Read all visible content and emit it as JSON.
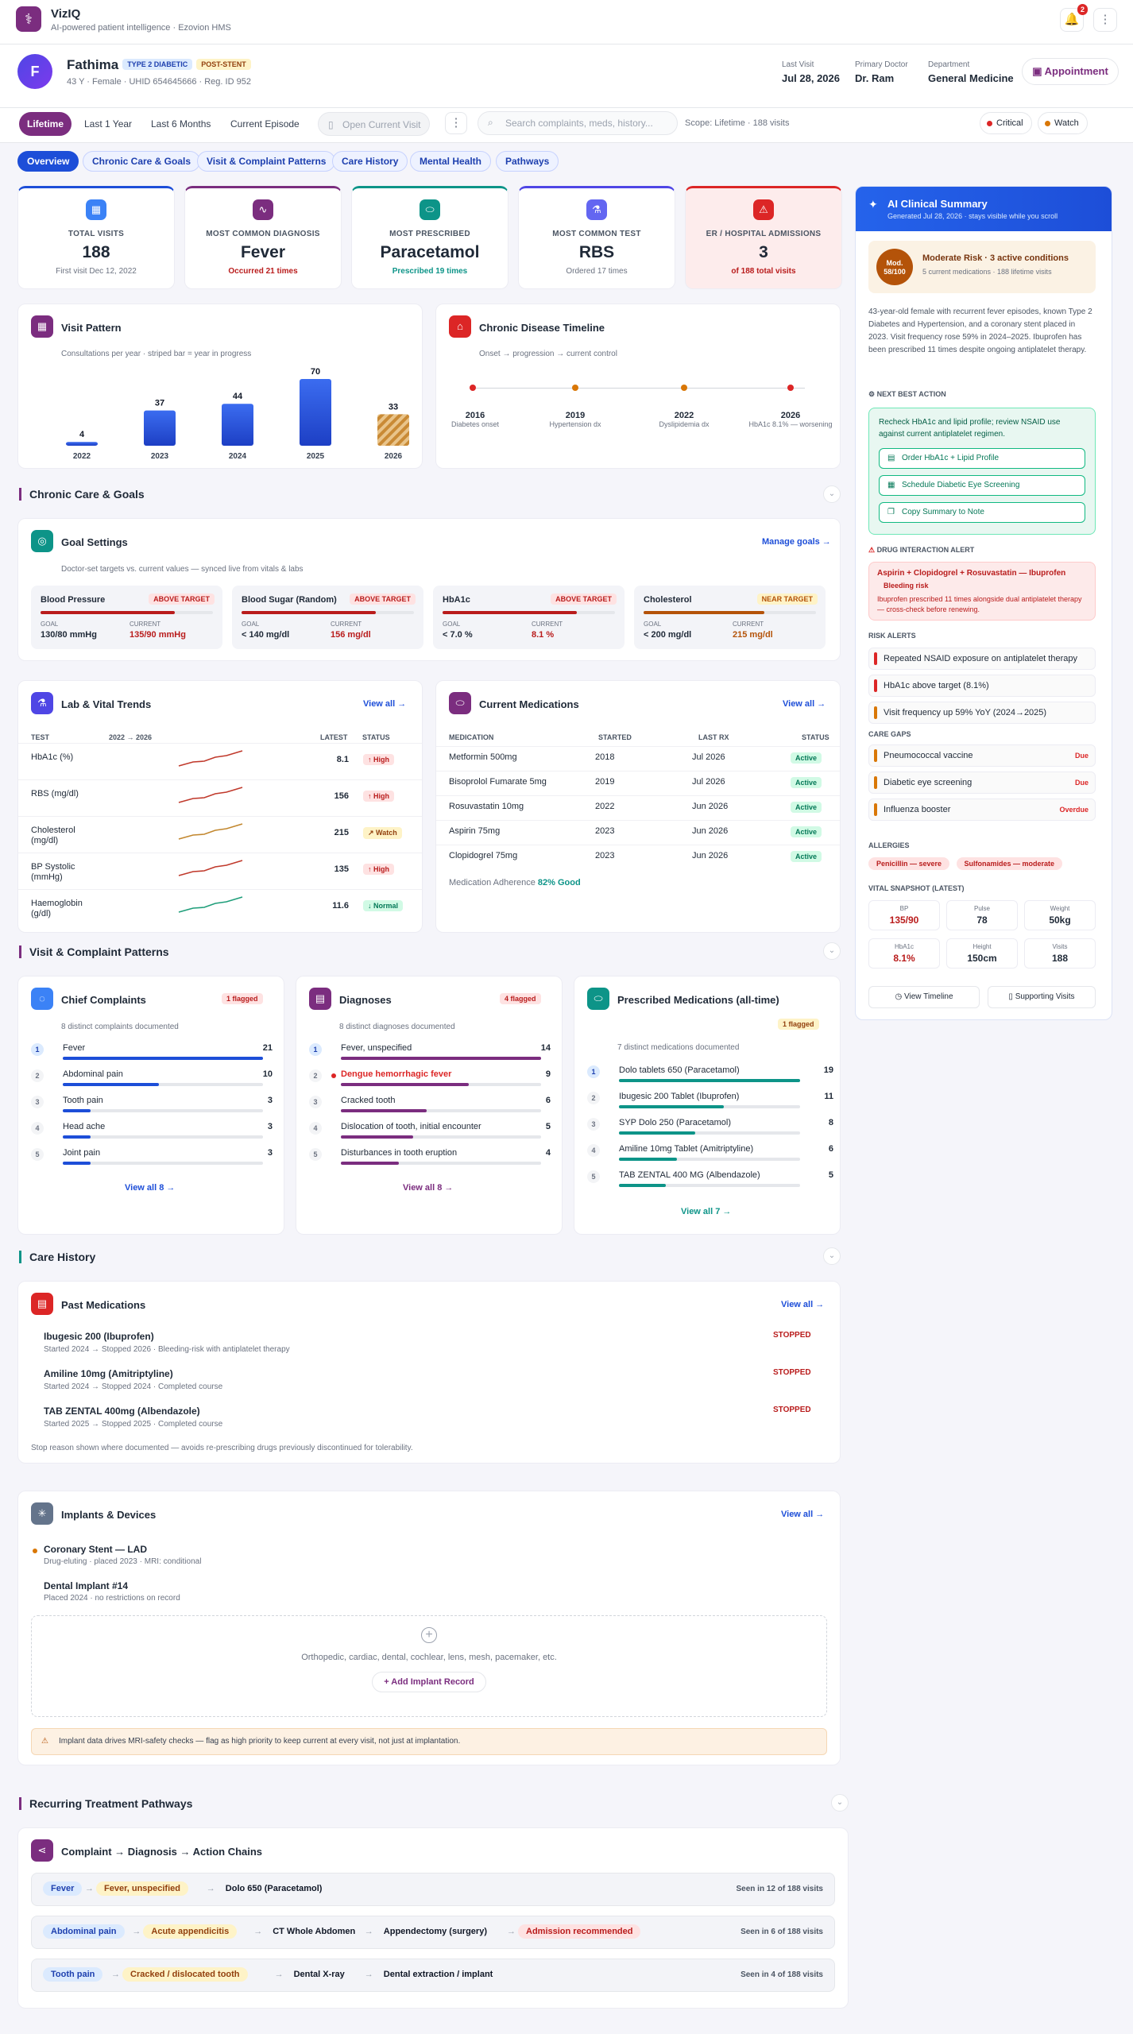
{
  "app": {
    "title": "VizIQ",
    "subtitle": "AI-powered patient intelligence · Ezovion HMS",
    "notifications": "2"
  },
  "patient": {
    "initial": "F",
    "name": "Fathima",
    "tags": [
      "TYPE 2 DIABETIC",
      "POST-STENT"
    ],
    "meta": "43 Y · Female · UHID 654645666 · Reg. ID 952",
    "last_visit_label": "Last Visit",
    "last_visit": "Jul 28, 2026",
    "doctor_label": "Primary Doctor",
    "doctor": "Dr. Ram",
    "dept_label": "Department",
    "dept": "General Medicine",
    "appointment": "Appointment"
  },
  "filters": {
    "chips": [
      "Lifetime",
      "Last 1 Year",
      "Last 6 Months",
      "Current Episode"
    ],
    "open_visit": "Open Current Visit",
    "search_placeholder": "Search complaints, meds, history...",
    "scope": "Scope: Lifetime · 188 visits",
    "legend": [
      "Critical",
      "Watch"
    ]
  },
  "tabs": [
    "Overview",
    "Chronic Care & Goals",
    "Visit & Complaint Patterns",
    "Care History",
    "Mental Health",
    "Pathways"
  ],
  "stats": [
    {
      "label": "TOTAL VISITS",
      "value": "188",
      "sub": "First visit Dec 12, 2022"
    },
    {
      "label": "MOST COMMON DIAGNOSIS",
      "value": "Fever",
      "sub": "Occurred 21 times"
    },
    {
      "label": "MOST PRESCRIBED",
      "value": "Paracetamol",
      "sub": "Prescribed 19 times"
    },
    {
      "label": "MOST COMMON TEST",
      "value": "RBS",
      "sub": "Ordered 17 times"
    },
    {
      "label": "ER / HOSPITAL ADMISSIONS",
      "value": "3",
      "sub": "of 188 total visits"
    }
  ],
  "visit_pattern": {
    "title": "Visit Pattern",
    "subtitle": "Consultations per year · striped bar = year in progress",
    "chart_data": {
      "type": "bar",
      "categories": [
        "2022",
        "2023",
        "2024",
        "2025",
        "2026"
      ],
      "values": [
        4,
        37,
        44,
        70,
        33
      ],
      "title": "Visit Pattern"
    }
  },
  "chronic_timeline": {
    "title": "Chronic Disease Timeline",
    "subtitle": "Onset → progression → current control",
    "events": [
      {
        "year": "2016",
        "label": "Diabetes onset"
      },
      {
        "year": "2019",
        "label": "Hypertension dx"
      },
      {
        "year": "2022",
        "label": "Dyslipidemia dx"
      },
      {
        "year": "2026",
        "label": "HbA1c 8.1% — worsening"
      }
    ]
  },
  "sections": {
    "chronic": "Chronic Care & Goals",
    "patterns": "Visit & Complaint Patterns",
    "history": "Care History",
    "pathways": "Recurring Treatment Pathways"
  },
  "goals": {
    "title": "Goal Settings",
    "subtitle": "Doctor-set targets vs. current values — synced live from vitals & labs",
    "manage": "Manage goals →",
    "goal_label": "GOAL",
    "current_label": "CURRENT",
    "items": [
      {
        "name": "Blood Pressure",
        "status": "ABOVE TARGET",
        "goal": "130/80 mmHg",
        "current": "135/90 mmHg"
      },
      {
        "name": "Blood Sugar (Random)",
        "status": "ABOVE TARGET",
        "goal": "< 140 mg/dl",
        "current": "156 mg/dl"
      },
      {
        "name": "HbA1c",
        "status": "ABOVE TARGET",
        "goal": "< 7.0 %",
        "current": "8.1 %"
      },
      {
        "name": "Cholesterol",
        "status": "NEAR TARGET",
        "goal": "< 200 mg/dl",
        "current": "215 mg/dl"
      }
    ]
  },
  "labs": {
    "title": "Lab & Vital Trends",
    "view_all": "View all →",
    "headers": [
      "TEST",
      "2022 → 2026",
      "LATEST",
      "STATUS"
    ],
    "rows": [
      {
        "test": "HbA1c (%)",
        "latest": "8.1",
        "status": "↑ High"
      },
      {
        "test": "RBS (mg/dl)",
        "latest": "156",
        "status": "↑ High"
      },
      {
        "test": "Cholesterol (mg/dl)",
        "latest": "215",
        "status": "↗ Watch"
      },
      {
        "test": "BP Systolic (mmHg)",
        "latest": "135",
        "status": "↑ High"
      },
      {
        "test": "Haemoglobin (g/dl)",
        "latest": "11.6",
        "status": "↓ Normal"
      }
    ]
  },
  "meds": {
    "title": "Current Medications",
    "view_all": "View all →",
    "headers": [
      "MEDICATION",
      "STARTED",
      "LAST RX",
      "STATUS"
    ],
    "rows": [
      {
        "name": "Metformin 500mg",
        "started": "2018",
        "last": "Jul 2026",
        "status": "Active"
      },
      {
        "name": "Bisoprolol Fumarate 5mg",
        "started": "2019",
        "last": "Jul 2026",
        "status": "Active"
      },
      {
        "name": "Rosuvastatin 10mg",
        "started": "2022",
        "last": "Jun 2026",
        "status": "Active"
      },
      {
        "name": "Aspirin 75mg",
        "started": "2023",
        "last": "Jun 2026",
        "status": "Active"
      },
      {
        "name": "Clopidogrel 75mg",
        "started": "2023",
        "last": "Jun 2026",
        "status": "Active"
      }
    ],
    "adherence_label": "Medication Adherence",
    "adherence": "82% Good"
  },
  "complaints": {
    "title": "Chief Complaints",
    "flag": "1 flagged",
    "subtitle": "8 distinct complaints documented",
    "view_all": "View all 8 →",
    "items": [
      {
        "name": "Fever",
        "count": "21",
        "frac": 1.0
      },
      {
        "name": "Abdominal pain",
        "count": "10",
        "frac": 0.48
      },
      {
        "name": "Tooth pain",
        "count": "3",
        "frac": 0.14
      },
      {
        "name": "Head ache",
        "count": "3",
        "frac": 0.14
      },
      {
        "name": "Joint pain",
        "count": "3",
        "frac": 0.14
      }
    ]
  },
  "diagnoses": {
    "title": "Diagnoses",
    "flag": "4 flagged",
    "subtitle": "8 distinct diagnoses documented",
    "view_all": "View all 8 →",
    "items": [
      {
        "name": "Fever, unspecified",
        "count": "14",
        "frac": 1.0
      },
      {
        "name": "Dengue hemorrhagic fever",
        "count": "9",
        "frac": 0.64
      },
      {
        "name": "Cracked tooth",
        "count": "6",
        "frac": 0.43
      },
      {
        "name": "Dislocation of tooth, initial encounter",
        "count": "5",
        "frac": 0.36
      },
      {
        "name": "Disturbances in tooth eruption",
        "count": "4",
        "frac": 0.29
      }
    ]
  },
  "prescribed": {
    "title": "Prescribed Medications (all-time)",
    "flag": "1 flagged",
    "subtitle": "7 distinct medications documented",
    "view_all": "View all 7 →",
    "items": [
      {
        "name": "Dolo tablets 650 (Paracetamol)",
        "count": "19",
        "frac": 1.0
      },
      {
        "name": "Ibugesic 200 Tablet (Ibuprofen)",
        "count": "11",
        "frac": 0.58
      },
      {
        "name": "SYP Dolo 250 (Paracetamol)",
        "count": "8",
        "frac": 0.42
      },
      {
        "name": "Amiline 10mg Tablet (Amitriptyline)",
        "count": "6",
        "frac": 0.32
      },
      {
        "name": "TAB ZENTAL 400 MG (Albendazole)",
        "count": "5",
        "frac": 0.26
      }
    ]
  },
  "past_meds": {
    "title": "Past Medications",
    "view_all": "View all →",
    "items": [
      {
        "name": "Ibugesic 200 (Ibuprofen)",
        "detail": "Started 2024 → Stopped 2026 · Bleeding-risk with antiplatelet therapy",
        "status": "STOPPED"
      },
      {
        "name": "Amiline 10mg (Amitriptyline)",
        "detail": "Started 2024 → Stopped 2024 · Completed course",
        "status": "STOPPED"
      },
      {
        "name": "TAB ZENTAL 400mg (Albendazole)",
        "detail": "Started 2025 → Stopped 2025 · Completed course",
        "status": "STOPPED"
      }
    ],
    "note": "Stop reason shown where documented — avoids re-prescribing drugs previously discontinued for tolerability."
  },
  "implants": {
    "title": "Implants & Devices",
    "view_all": "View all →",
    "items": [
      {
        "name": "Coronary Stent — LAD",
        "detail": "Drug-eluting · placed 2023 · MRI: conditional"
      },
      {
        "name": "Dental Implant #14",
        "detail": "Placed 2024 · no restrictions on record"
      }
    ],
    "empty_text": "Orthopedic, cardiac, dental, cochlear, lens, mesh, pacemaker, etc.",
    "add": "+ Add Implant Record",
    "warning": "Implant data drives MRI-safety checks — flag as high priority to keep current at every visit, not just at implantation."
  },
  "pathways": {
    "title": "Complaint → Diagnosis → Action Chains",
    "chains": [
      {
        "steps": [
          "Fever",
          "Fever, unspecified",
          "Dolo 650 (Paracetamol)"
        ],
        "seen": "Seen in 12 of 188 visits"
      },
      {
        "steps": [
          "Abdominal pain",
          "Acute appendicitis",
          "CT Whole Abdomen",
          "Appendectomy (surgery)",
          "Admission recommended"
        ],
        "seen": "Seen in 6 of 188 visits"
      },
      {
        "steps": [
          "Tooth pain",
          "Cracked / dislocated tooth",
          "Dental X-ray",
          "Dental extraction / implant"
        ],
        "seen": "Seen in 4 of 188 visits"
      }
    ]
  },
  "ai": {
    "title": "AI Clinical Summary",
    "subtitle": "Generated Jul 28, 2026 · stays visible while you scroll",
    "risk_badge": "Mod. 58/100",
    "risk_title": "Moderate Risk · 3 active conditions",
    "risk_sub": "5 current medications · 188 lifetime visits",
    "summary": "43-year-old female with recurrent fever episodes, known Type 2 Diabetes and Hypertension, and a coronary stent placed in 2023. Visit frequency rose 59% in 2024–2025. Ibuprofen has been prescribed 11 times despite ongoing antiplatelet therapy.",
    "nba_label": "NEXT BEST ACTION",
    "nba_text": "Recheck HbA1c and lipid profile; review NSAID use against current antiplatelet regimen.",
    "nba_buttons": [
      "Order HbA1c + Lipid Profile",
      "Schedule Diabetic Eye Screening",
      "Copy Summary to Note"
    ],
    "dia_label": "DRUG INTERACTION ALERT",
    "dia_title": "Aspirin + Clopidogrel + Rosuvastatin — Ibuprofen",
    "dia_risk": "Bleeding risk",
    "dia_text": "Ibuprofen prescribed 11 times alongside dual antiplatelet therapy — cross-check before renewing.",
    "risk_label": "RISK ALERTS",
    "risks": [
      "Repeated NSAID exposure on antiplatelet therapy",
      "HbA1c above target (8.1%)",
      "Visit frequency up 59% YoY (2024→2025)"
    ],
    "gaps_label": "CARE GAPS",
    "gaps": [
      {
        "name": "Pneumococcal vaccine",
        "status": "Due"
      },
      {
        "name": "Diabetic eye screening",
        "status": "Due"
      },
      {
        "name": "Influenza booster",
        "status": "Overdue"
      }
    ],
    "allergy_label": "ALLERGIES",
    "allergies": [
      "Penicillin — severe",
      "Sulfonamides — moderate"
    ],
    "vitals_label": "VITAL SNAPSHOT (LATEST)",
    "vitals": [
      {
        "l": "BP",
        "v": "135/90"
      },
      {
        "l": "Pulse",
        "v": "78"
      },
      {
        "l": "Weight",
        "v": "50kg"
      },
      {
        "l": "HbA1c",
        "v": "8.1%"
      },
      {
        "l": "Height",
        "v": "150cm"
      },
      {
        "l": "Visits",
        "v": "188"
      }
    ],
    "btn_timeline": "View Timeline",
    "btn_visits": "Supporting Visits"
  }
}
